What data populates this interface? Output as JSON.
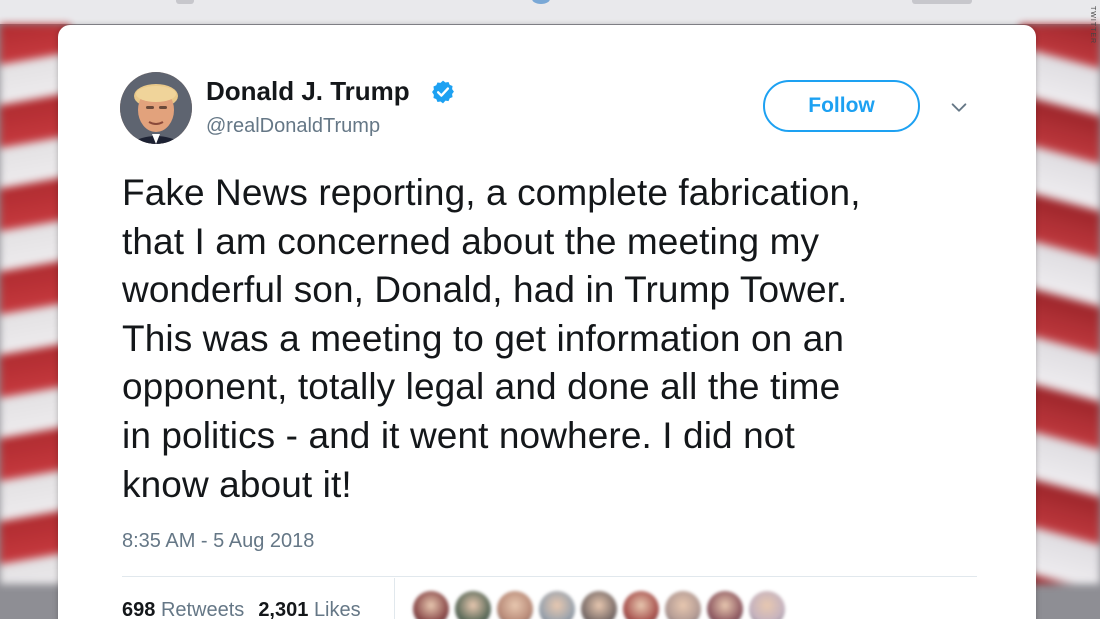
{
  "watermark": "TWITTER",
  "tweet": {
    "author_name": "Donald J. Trump",
    "author_handle": "@realDonaldTrump",
    "verified": true,
    "follow_label": "Follow",
    "text_lines": [
      "Fake News reporting, a complete fabrication,",
      "that I am concerned about the meeting my",
      "wonderful son, Donald, had in Trump Tower.",
      "This was a meeting to get information on an",
      "opponent, totally legal and done all the time",
      "in politics - and it went nowhere. I did not",
      "know about it!"
    ],
    "timestamp": "8:35 AM - 5 Aug 2018",
    "stats": {
      "retweets_count": "698",
      "retweets_label": "Retweets",
      "likes_count": "2,301",
      "likes_label": "Likes"
    }
  },
  "icons": {
    "verified": "verified-badge-icon",
    "menu": "chevron-down-icon"
  },
  "colors": {
    "accent": "#1da1f2",
    "text_primary": "#14171a",
    "text_secondary": "#657786",
    "divider": "#e1e8ed"
  },
  "liker_avatar_colors": [
    "#8a4a4a",
    "#5c6b5a",
    "#b88a78",
    "#9aa3ad",
    "#7c6e6a",
    "#a8534f",
    "#b29a94",
    "#8f5a62",
    "#c4b2bf"
  ]
}
